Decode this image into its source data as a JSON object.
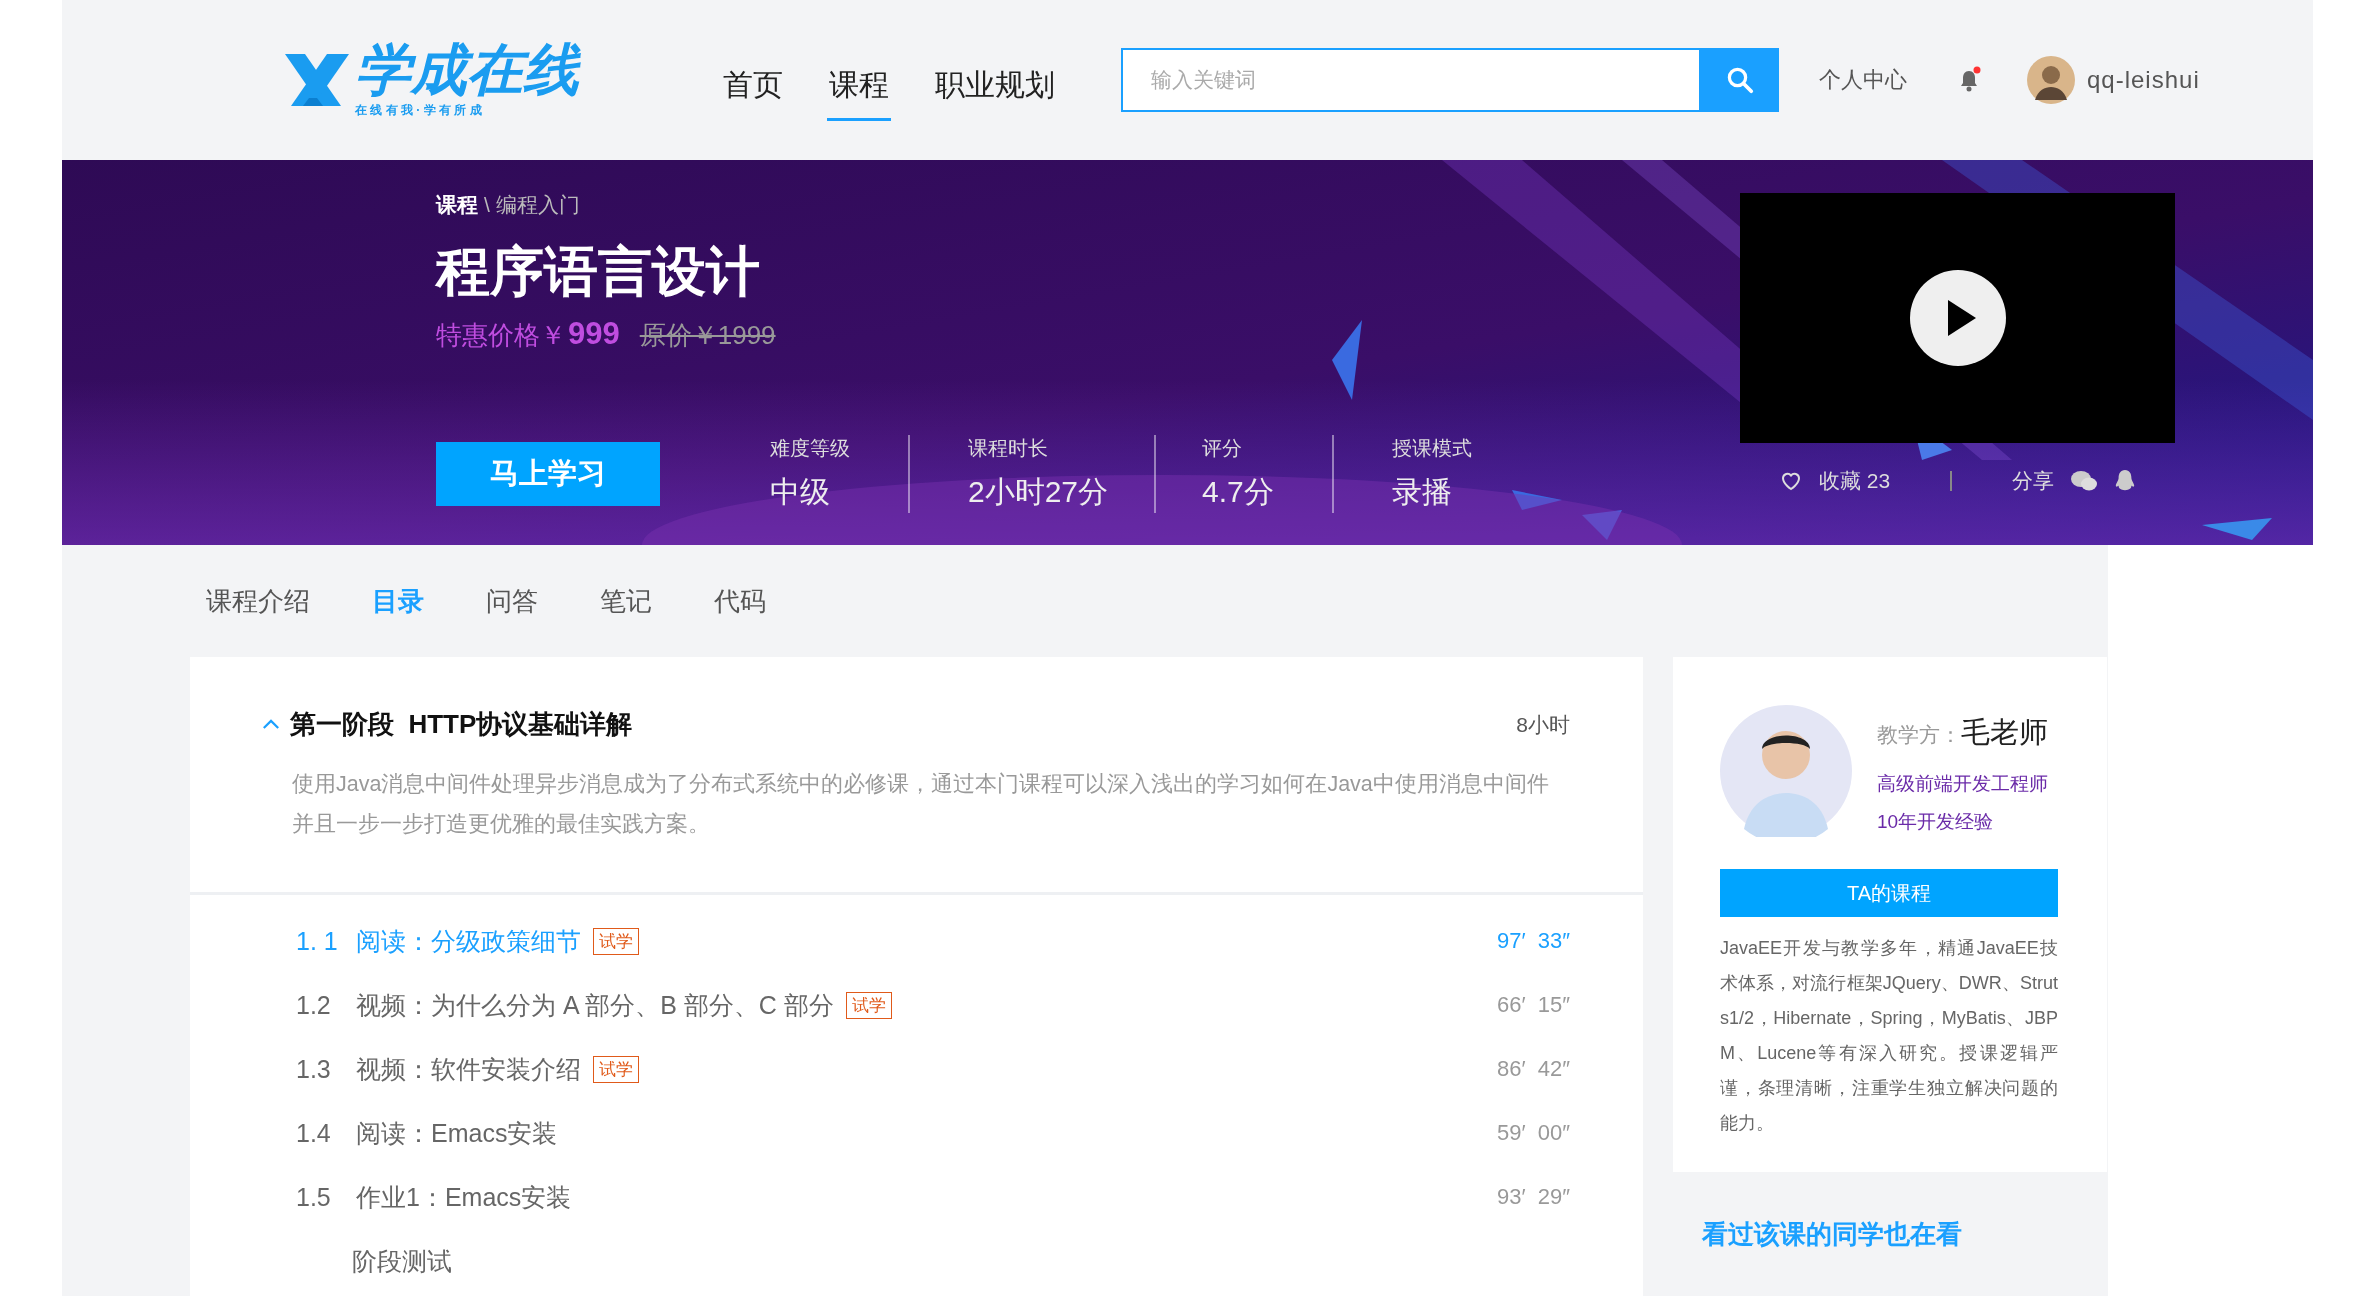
{
  "header": {
    "logo": {
      "name": "学成在线",
      "tagline": "在 线 有 我 · 学 有 所 成"
    },
    "nav": [
      {
        "label": "首页",
        "selected": false
      },
      {
        "label": "课程",
        "selected": true
      },
      {
        "label": "职业规划",
        "selected": false
      }
    ],
    "search": {
      "placeholder": "输入关键词"
    },
    "user_center": "个人中心",
    "notification": {
      "unread": true
    },
    "username": "qq-leishui"
  },
  "course": {
    "breadcrumb": [
      {
        "label": "课程"
      },
      {
        "label": "编程入门"
      }
    ],
    "separator": "\\",
    "title": "程序语言设计",
    "price": {
      "label": "特惠价格￥",
      "value": "999"
    },
    "original_price": "原价￥1999",
    "cta": "马上学习",
    "stats": [
      {
        "label": "难度等级",
        "value": "中级"
      },
      {
        "label": "课程时长",
        "value": "2小时27分"
      },
      {
        "label": "评分",
        "value": "4.7分"
      },
      {
        "label": "授课模式",
        "value": "录播"
      }
    ],
    "favorite": "收藏 23",
    "share": "分享"
  },
  "tabs": [
    {
      "label": "课程介绍",
      "selected": false
    },
    {
      "label": "目录",
      "selected": true
    },
    {
      "label": "问答",
      "selected": false
    },
    {
      "label": "笔记",
      "selected": false
    },
    {
      "label": "代码",
      "selected": false
    }
  ],
  "chapter": {
    "title": "第一阶段  HTTP协议基础详解",
    "duration": "8小时",
    "expanded": true,
    "description": "使用Java消息中间件处理异步消息成为了分布式系统中的必修课，通过本门课程可以深入浅出的学习如何在Java中使用消息中间件并且一步一步打造更优雅的最佳实践方案。",
    "lessons": [
      {
        "kind": "lesson",
        "number": "1. 1",
        "title": "阅读：分级政策细节",
        "tag": "试学",
        "duration": "97′  33″",
        "selected": true
      },
      {
        "kind": "lesson",
        "number": "1.2",
        "title": "视频：为什么分为 A 部分、B 部分、C 部分",
        "tag": "试学",
        "duration": "66′  15″",
        "selected": false
      },
      {
        "kind": "lesson",
        "number": "1.3",
        "title": "视频：软件安装介绍",
        "tag": "试学",
        "duration": "86′  42″",
        "selected": false
      },
      {
        "kind": "lesson",
        "number": "1.4",
        "title": "阅读：Emacs安装",
        "duration": "59′  00″",
        "selected": false
      },
      {
        "kind": "lesson",
        "number": "1.5",
        "title": "作业1：Emacs安装",
        "duration": "93′  29″",
        "selected": false
      },
      {
        "kind": "test",
        "title": "阶段测试",
        "selected": false
      }
    ]
  },
  "teacher": {
    "label": "教学方：",
    "name": "毛老师",
    "titles": [
      "高级前端开发工程师",
      "10年开发经验"
    ],
    "button": "TA的课程",
    "bio": "JavaEE开发与教学多年，精通JavaEE技术体系，对流行框架JQuery、DWR、Struts1/2，Hibernate，Spring，MyBatis、JBPM、Lucene等有深入研究。授课逻辑严谨，条理清晰，注重学生独立解决问题的能力。"
  },
  "related": {
    "title": "看过该课的同学也在看"
  }
}
